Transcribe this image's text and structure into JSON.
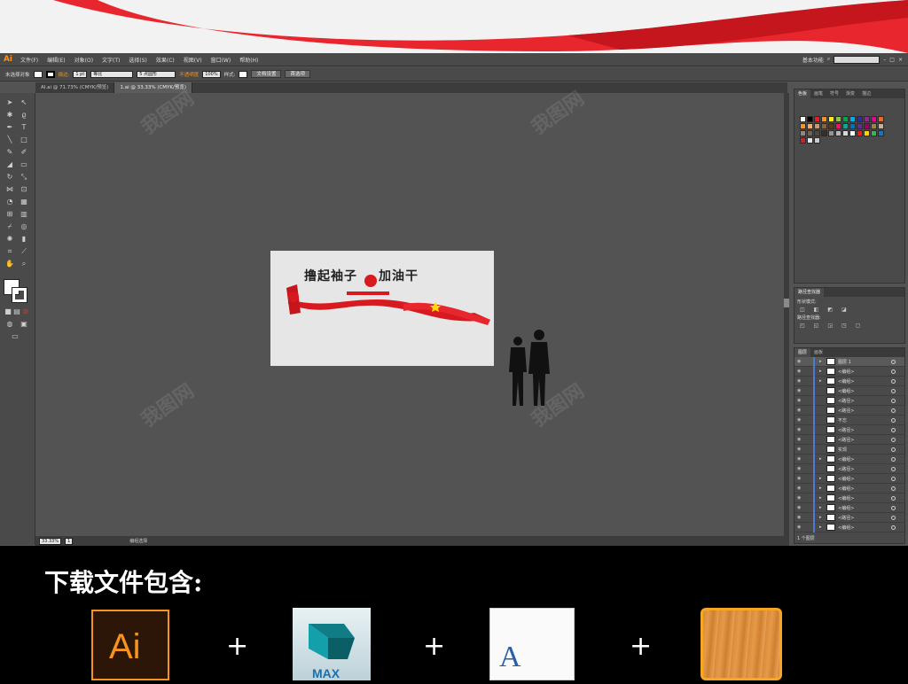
{
  "menubar": {
    "logo": "Ai",
    "items": [
      "文件(F)",
      "编辑(E)",
      "对象(O)",
      "文字(T)",
      "选择(S)",
      "效果(C)",
      "视图(V)",
      "窗口(W)",
      "帮助(H)"
    ],
    "workspace": "基本功能"
  },
  "control_bar": {
    "selection": "未选择对象",
    "stroke_label": "描边:",
    "stroke_value": "1 pt",
    "stroke_style": "等比",
    "brush": "5 点圆形",
    "opacity_label": "不透明度",
    "opacity_value": "100%",
    "style_label": "样式:",
    "doc_setup": "文档设置",
    "preferences": "首选项"
  },
  "tabs": [
    "AI.ai @ 71.73% (CMYK/预览)",
    "1.ai @ 33.33% (CMYK/预览)"
  ],
  "artwork": {
    "title_left": "撸起袖子",
    "title_right": "加油干"
  },
  "statusbar": {
    "zoom": "33.33%",
    "page": "1",
    "tool": "编组选择"
  },
  "swatches_panel": {
    "tabs": [
      "色板",
      "画笔",
      "符号",
      "渐变",
      "描边",
      "符号"
    ],
    "colors": [
      "#ffffff",
      "#000000",
      "#ed1c24",
      "#f7931e",
      "#fff200",
      "#8dc63f",
      "#00a651",
      "#00aeef",
      "#2e3192",
      "#92278f",
      "#ec008c",
      "#f26522",
      "#f7941d",
      "#fbaf5d",
      "#c69c6d",
      "#8c6239",
      "#603913",
      "#ed145b",
      "#00a99d",
      "#0072bc",
      "#662d91",
      "#9e005d",
      "#a67c52",
      "#c7b299",
      "#998675",
      "#736357",
      "#534741",
      "#362f2d",
      "#959595",
      "#b7b7b7",
      "#d9d9d9",
      "#ffffff",
      "#ec1c24",
      "#ffd200",
      "#39b54a",
      "#1b75bc",
      "#c1272d",
      "#e6e6e6",
      "#cccccc"
    ]
  },
  "pathfinder_panel": {
    "title": "路径查找器",
    "shape_modes": "形状模式:",
    "pathfinders": "路径查找器:"
  },
  "layers_panel": {
    "tabs": [
      "图层",
      "画板"
    ],
    "rows": [
      "图层 1",
      "<编组>",
      "<编组>",
      "<编组>",
      "<路径>",
      "<路径>",
      "不忘",
      "<路径>",
      "<路径>",
      "实现",
      "<编组>",
      "<路径>",
      "<编组>",
      "<编组>",
      "<编组>",
      "<编组>",
      "<路径>",
      "<编组>"
    ],
    "footer": "1 个图层"
  },
  "bottom": {
    "heading": "下载文件包含:",
    "max_label": "MAX",
    "ai_label": "Ai",
    "font_glyph": "A"
  },
  "watermark": "我图网"
}
